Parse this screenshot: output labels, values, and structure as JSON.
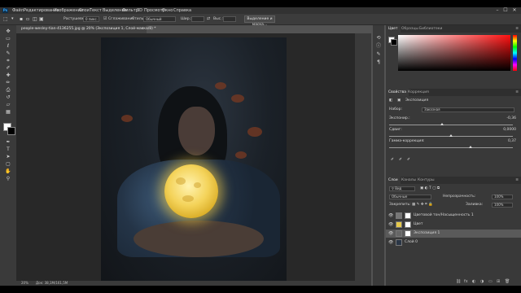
{
  "menubar": {
    "logo": "Ps",
    "items": [
      "Файл",
      "Редактирование",
      "Изображение",
      "Слои",
      "Текст",
      "Выделение",
      "Фильтр",
      "3D",
      "Просмотр",
      "Окно",
      "Справка"
    ],
    "win_min": "–",
    "win_max": "☐",
    "win_close": "✕"
  },
  "options": {
    "feather_label": "Растушевка:",
    "feather_value": "0 пикс.",
    "antialias_label": "Сглаживание",
    "style_label": "Стиль:",
    "style_value": "Обычный",
    "width_label": "Шир.:",
    "height_label": "Выс.:",
    "select_mask_button": "Выделение и маска..."
  },
  "tools": {
    "move": "✥",
    "marquee": "▭",
    "lasso": "ℓ",
    "quick_select": "✎",
    "crop": "⌗",
    "eyedropper": "✐",
    "heal": "✚",
    "brush": "✏",
    "stamp": "⎙",
    "history": "↺",
    "eraser": "▱",
    "gradient": "▦",
    "dodge": "●",
    "pen": "✒",
    "type": "T",
    "path_select": "➤",
    "shape": "▢",
    "hand": "✋",
    "zoom": "⚲"
  },
  "document": {
    "tab_title": "people-wesley-tian-4136255.jpg @ 20% (Экспозиция 1, Слой-маска/8) *",
    "tab_close": "×",
    "zoom_status": "20%",
    "doc_size_status": "Док: 38,1M/161,5M"
  },
  "color_panel": {
    "tabs": [
      "Цвет",
      "Образцы",
      "Библиотеки"
    ],
    "menu": "≡"
  },
  "properties_panel": {
    "tabs": [
      "Свойства",
      "Коррекция"
    ],
    "menu": "≡",
    "adjustment_name": "Экспозиция",
    "preset_label": "Набор:",
    "preset_value": "Заказная",
    "exposure_label": "Экспонир.:",
    "exposure_value": "-0,36",
    "exposure_level": 0.43,
    "offset_label": "Сдвиг:",
    "offset_value": "0,0000",
    "offset_level": 0.5,
    "gamma_label": "Гамма-коррекция:",
    "gamma_value": "0,37",
    "gamma_level": 0.66
  },
  "layers_panel": {
    "tabs": [
      "Слои",
      "Каналы",
      "Контуры"
    ],
    "menu": "≡",
    "filter_label": "Вид",
    "blend_mode": "Обычные",
    "opacity_label": "Непрозрачность:",
    "opacity_value": "100%",
    "lock_label": "Закрепить:",
    "fill_label": "Заливка:",
    "fill_value": "100%",
    "layers": [
      {
        "name": "Цветовой тон/Насыщенность 1",
        "visible": true,
        "selected": false
      },
      {
        "name": "Цвет",
        "visible": true,
        "selected": false
      },
      {
        "name": "Экспозиция 1",
        "visible": true,
        "selected": true
      },
      {
        "name": "Слой 0",
        "visible": true,
        "selected": false
      }
    ],
    "bottom_icons": [
      "⛓",
      "fx",
      "◐",
      "◑",
      "▭",
      "⊞",
      "🗑"
    ]
  }
}
